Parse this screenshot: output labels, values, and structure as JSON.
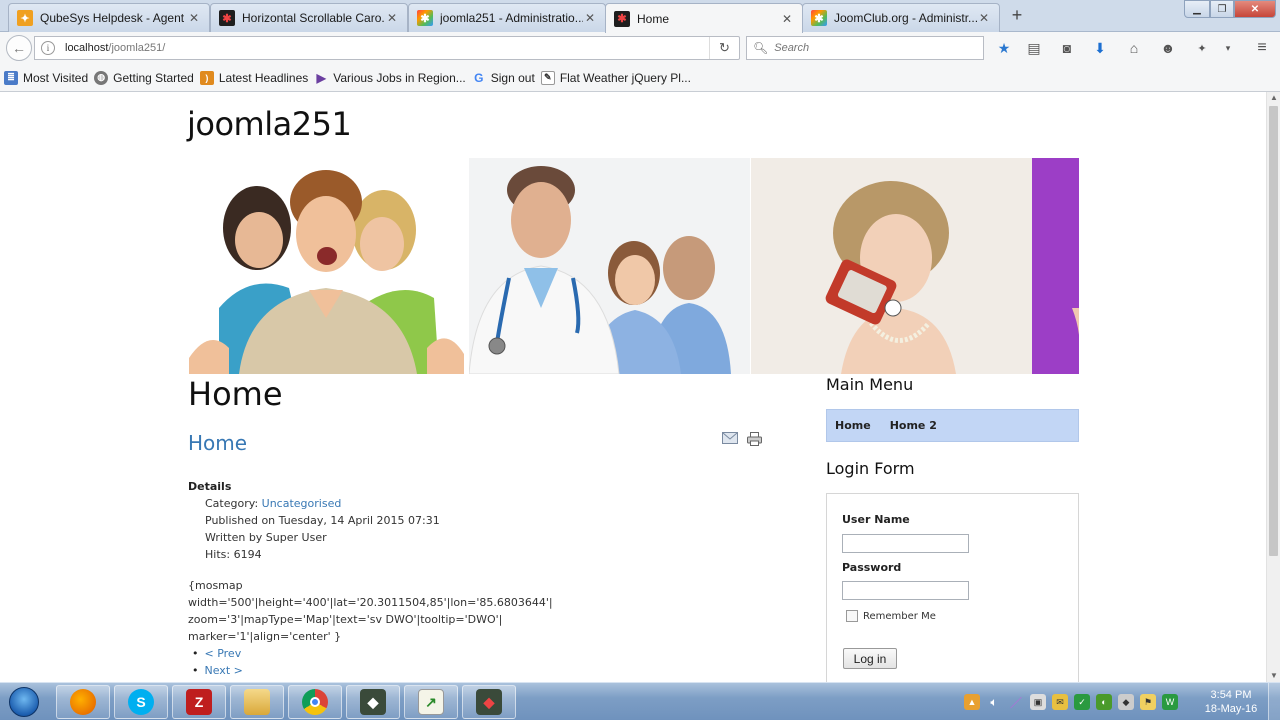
{
  "browser": {
    "tabs": [
      {
        "title": "QubeSys Helpdesk - Agent",
        "active": false
      },
      {
        "title": "Horizontal Scrollable Caro...",
        "active": false
      },
      {
        "title": "joomla251 - Administratio...",
        "active": false
      },
      {
        "title": "Home",
        "active": true
      },
      {
        "title": "JoomClub.org - Administr...",
        "active": false
      }
    ],
    "url_host": "localhost",
    "url_path": "/joomla251/",
    "search_placeholder": "Search",
    "bookmarks": [
      {
        "label": "Most Visited",
        "icon": "bookmarks-icon"
      },
      {
        "label": "Getting Started",
        "icon": "globe-icon"
      },
      {
        "label": "Latest Headlines",
        "icon": "rss-icon"
      },
      {
        "label": "Various Jobs in Region...",
        "icon": "triangle-icon"
      },
      {
        "label": "Sign out",
        "icon": "google-icon"
      },
      {
        "label": "Flat Weather jQuery Pl...",
        "icon": "page-icon"
      }
    ]
  },
  "page": {
    "site_title": "joomla251",
    "heading": "Home",
    "article": {
      "title": "Home",
      "details_label": "Details",
      "category_prefix": "Category: ",
      "category": "Uncategorised",
      "published": "Published on Tuesday, 14 April 2015 07:31",
      "author": "Written by Super User",
      "hits": "Hits: 6194",
      "body": "{mosmap width='500'|height='400'|lat='20.3011504,85'|lon='85.6803644'|\nzoom='3'|mapType='Map'|text='sv DWO'|tooltip='DWO'|\nmarker='1'|align='center' }",
      "prev": "< Prev",
      "next": "Next >"
    },
    "main_menu": {
      "title": "Main Menu",
      "items": [
        "Home",
        "Home 2"
      ]
    },
    "login_form": {
      "title": "Login Form",
      "username_label": "User Name",
      "password_label": "Password",
      "remember_label": "Remember Me",
      "login_button": "Log in"
    }
  },
  "taskbar": {
    "time": "3:54 PM",
    "date": "18-May-16"
  }
}
